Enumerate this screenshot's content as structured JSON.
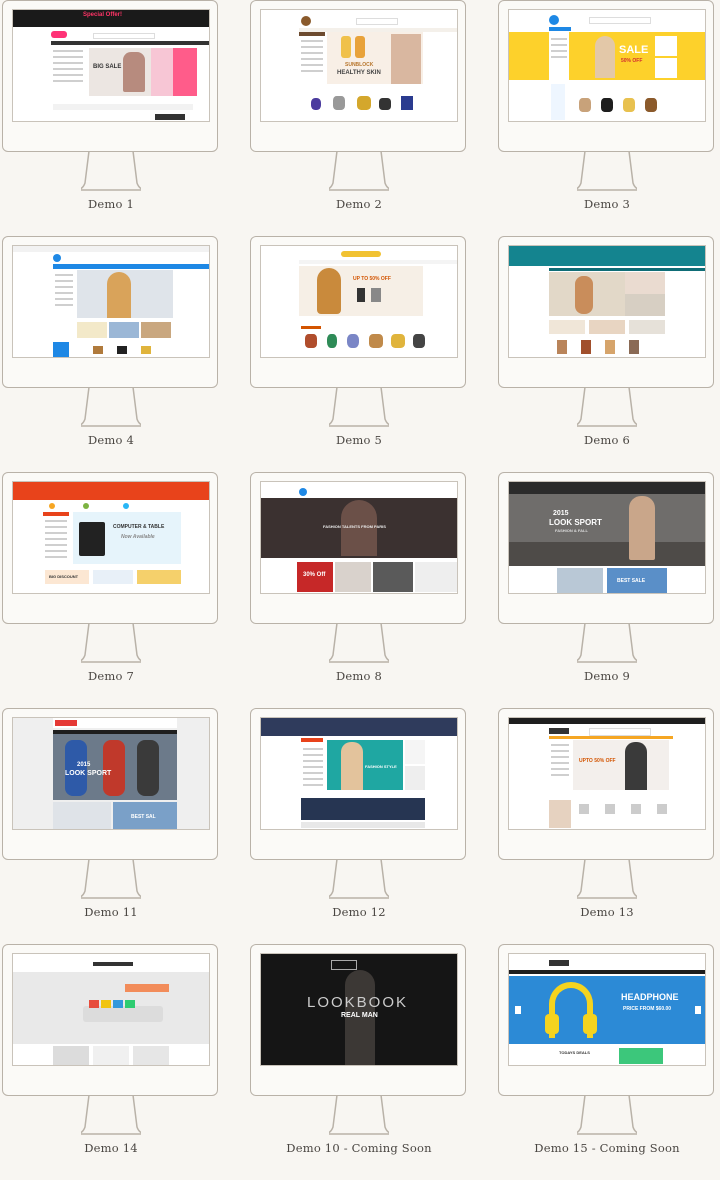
{
  "demos": [
    {
      "label": "Demo 1"
    },
    {
      "label": "Demo 2"
    },
    {
      "label": "Demo 3"
    },
    {
      "label": "Demo 4"
    },
    {
      "label": "Demo 5"
    },
    {
      "label": "Demo 6"
    },
    {
      "label": "Demo 7"
    },
    {
      "label": "Demo 8"
    },
    {
      "label": "Demo 9"
    },
    {
      "label": "Demo 11"
    },
    {
      "label": "Demo 12"
    },
    {
      "label": "Demo 13"
    },
    {
      "label": "Demo 14"
    },
    {
      "label": "Demo 10 - Coming Soon"
    },
    {
      "label": "Demo 15 - Coming Soon"
    }
  ],
  "screens": {
    "d1": {
      "offer": "Special Offer!",
      "banner": "BIG SALE"
    },
    "d2": {
      "banner_top": "SUNBLOCK",
      "banner": "HEALTHY SKIN"
    },
    "d3": {
      "banner": "SALE",
      "discount": "50% OFF"
    },
    "d5": {
      "banner": "UP TO 50% OFF"
    },
    "d7": {
      "banner": "COMPUTER & TABLE",
      "sub": "Now Available",
      "discount": "BIG DISCOUNT"
    },
    "d8": {
      "headline": "FASHION TALENTS FROM PARIS",
      "discount": "30% Off"
    },
    "d9": {
      "year": "2015",
      "banner": "LOOK SPORT",
      "sub": "FASHION & FALL",
      "tag": "BEST SALE"
    },
    "d11": {
      "year": "2015",
      "banner": "LOOK SPORT",
      "tag": "BEST SAL"
    },
    "d12": {
      "banner": "FASHION STYLE"
    },
    "d13": {
      "banner": "UPTO 50% OFF"
    },
    "d10": {
      "banner": "LOOKBOOK",
      "sub": "REAL MAN"
    },
    "d15": {
      "banner": "HEADPHONE",
      "price": "PRICE FROM $60.00",
      "tag": "TODAYS DEALS"
    }
  },
  "colors": {
    "label": "#4a4642",
    "frame": "#b9b2a8",
    "background": "#f8f6f2"
  }
}
